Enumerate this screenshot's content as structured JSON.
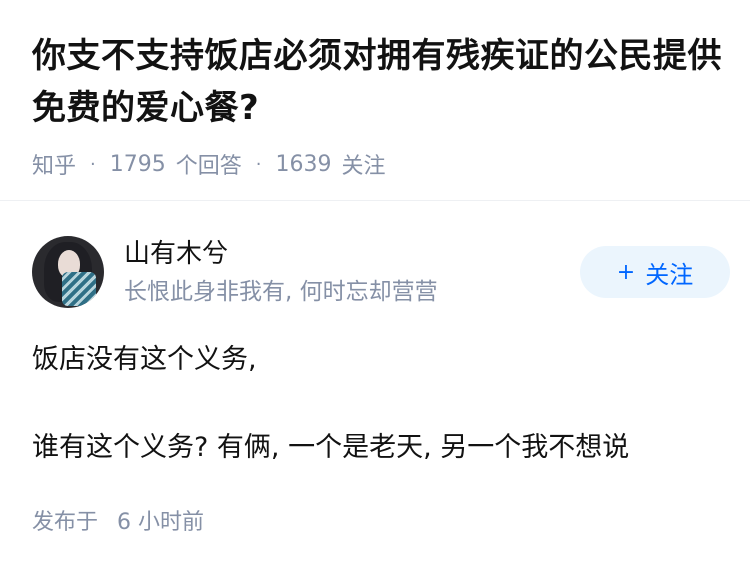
{
  "question": {
    "title": "你支不支持饭店必须对拥有残疾证的公民提供免费的爱心餐?",
    "source": "知乎",
    "answer_count": "1795",
    "answer_label": "个回答",
    "follow_count": "1639",
    "follow_label": "关注"
  },
  "author": {
    "name": "山有木兮",
    "bio": "长恨此身非我有, 何时忘却营营",
    "follow_button": "关注",
    "follow_icon": "plus-icon"
  },
  "answer": {
    "paragraphs": [
      "饭店没有这个义务,",
      "谁有这个义务? 有俩, 一个是老天, 另一个我不想说"
    ],
    "published_label": "发布于",
    "published_time": "6 小时前"
  }
}
